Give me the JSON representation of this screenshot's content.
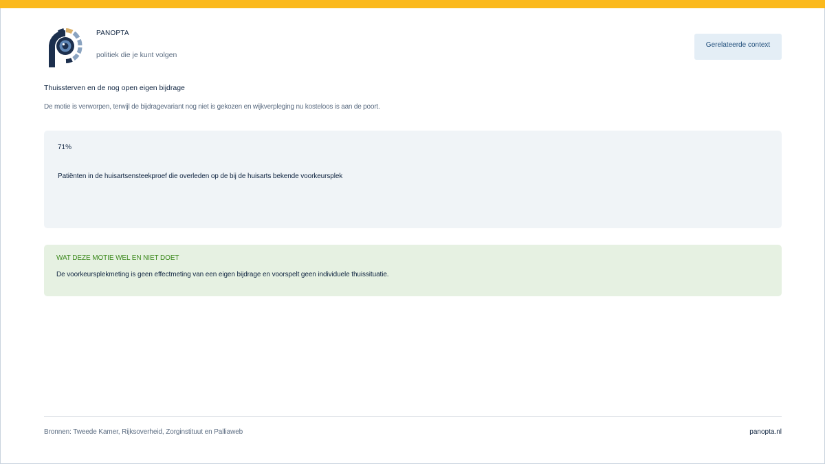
{
  "header": {
    "brand": "PANOPTA",
    "tagline": "politiek die je kunt volgen",
    "context_button": "Gerelateerde context"
  },
  "article": {
    "title": "Thuissterven en de nog open eigen bijdrage",
    "subtitle": "De motie is verworpen, terwijl de bijdragevariant nog niet is gekozen en wijkverpleging nu kosteloos is aan de poort."
  },
  "stat": {
    "value": "71%",
    "description": "Patiënten in de huisartsensteekproef die overleden op de bij de huisarts bekende voorkeursplek"
  },
  "note": {
    "heading": "WAT DEZE MOTIE WEL EN NIET DOET",
    "text": "De voorkeursplekmeting is geen effectmeting van een eigen bijdrage en voorspelt geen individuele thuissituatie."
  },
  "footer": {
    "sources": "Bronnen: Tweede Kamer, Rijksoverheid, Zorginstituut en Palliaweb",
    "site": "panopta.nl"
  },
  "colors": {
    "accent_bar": "#fbb91c",
    "navy": "#0f2440",
    "note_green": "#3d8a1e",
    "note_bg": "#e6f1e2",
    "stat_bg": "#f0f4f7"
  },
  "icons": {
    "logo": "panopta-eye-logo"
  }
}
